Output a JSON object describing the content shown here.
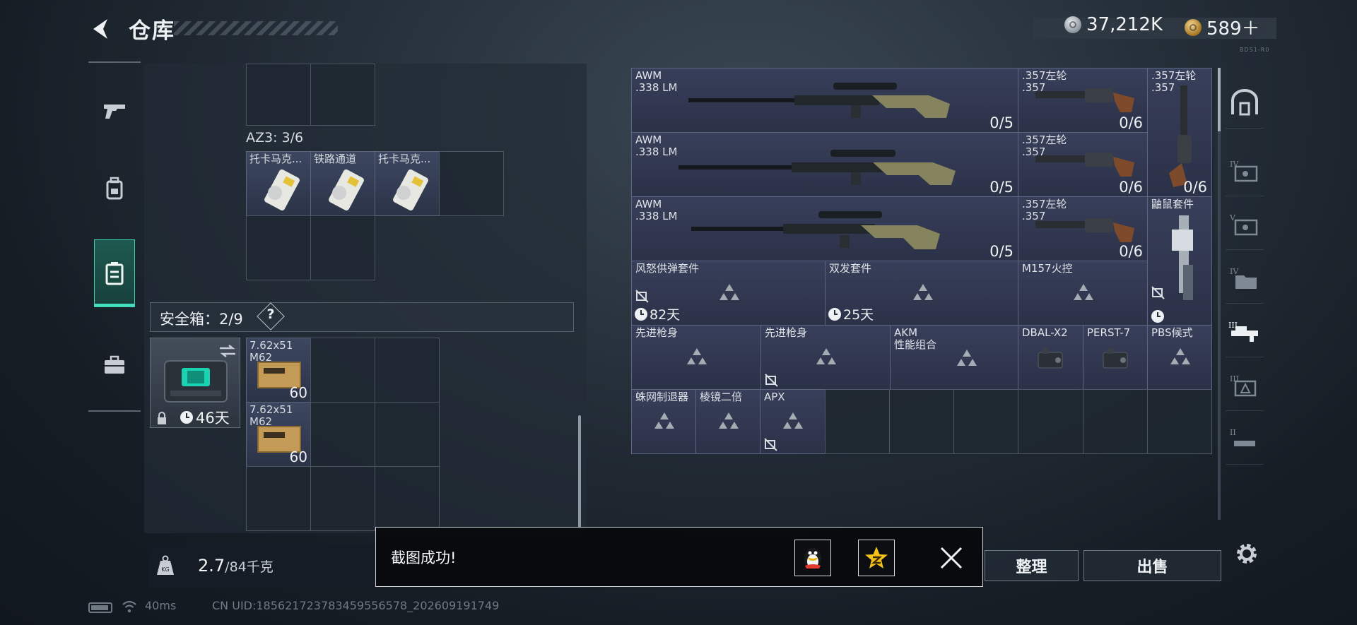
{
  "header": {
    "title": "仓库",
    "currency": [
      {
        "icon": "silver-coin-icon",
        "value": "37,212K"
      },
      {
        "icon": "gold-coin-icon",
        "value": "589＋"
      }
    ],
    "tiny_code": "BDS1-R0"
  },
  "left_nav": {
    "items": [
      {
        "name": "pistol-icon",
        "active": false
      },
      {
        "name": "backpack-icon",
        "active": false
      },
      {
        "name": "container-icon",
        "active": true
      },
      {
        "name": "briefcase-icon",
        "active": false
      }
    ]
  },
  "storage": {
    "az3_label": "AZ3: 3/6",
    "az3_items": [
      "托卡马克...",
      "铁路通道",
      "托卡马克..."
    ],
    "safe_box_label": "安全箱：2/9",
    "help_label": "?",
    "safe_box_days": "46天",
    "safe_items": [
      {
        "name": "7.62x51\nM62",
        "count": "60"
      },
      {
        "name": "7.62x51\nM62",
        "count": "60"
      }
    ]
  },
  "weight": {
    "current": "2.7",
    "max": "/84千克",
    "icon_label": "KG"
  },
  "grid": {
    "weapons": [
      {
        "name": "AWM\n.338 LM",
        "count": "0/5"
      },
      {
        "name": "AWM\n.338 LM",
        "count": "0/5"
      },
      {
        "name": "AWM\n.338 LM",
        "count": "0/5"
      }
    ],
    "revolvers": [
      {
        "name": ".357左轮\n.357",
        "count": "0/6"
      },
      {
        "name": ".357左轮\n.357",
        "count": "0/6"
      },
      {
        "name": ".357左轮\n.357",
        "count": "0/6"
      }
    ],
    "tall_revolver": {
      "name": ".357左轮\n.357",
      "count": "0/6"
    },
    "ratkit": {
      "name": "鼬鼠套件"
    },
    "kits": [
      {
        "name": "风怒供弹套件",
        "days": "82天"
      },
      {
        "name": "双发套件",
        "days": "25天"
      },
      {
        "name": "M157火控"
      }
    ],
    "row5": [
      {
        "name": "先进枪身"
      },
      {
        "name": "先进枪身"
      },
      {
        "name": "AKM\n性能组合"
      },
      {
        "name": "DBAL-X2"
      },
      {
        "name": "PERST-7"
      },
      {
        "name": "PBS候式"
      }
    ],
    "row6": [
      {
        "name": "蛛网制退器"
      },
      {
        "name": "棱镜二倍"
      },
      {
        "name": "APX"
      }
    ]
  },
  "buttons": {
    "sort_label": "整理",
    "sell_label": "出售"
  },
  "toast": {
    "text": "截图成功!",
    "share_qq_icon": "qq-penguin-icon",
    "share_qzone_icon": "qzone-star-icon"
  },
  "status_bar": {
    "ping": "40ms",
    "uid": "CN UID:18562172378345955657​8_202609191749"
  },
  "colors": {
    "accent": "#43e0bd",
    "item_bg": "#383f5a",
    "panel_bg": "#1c252e"
  }
}
